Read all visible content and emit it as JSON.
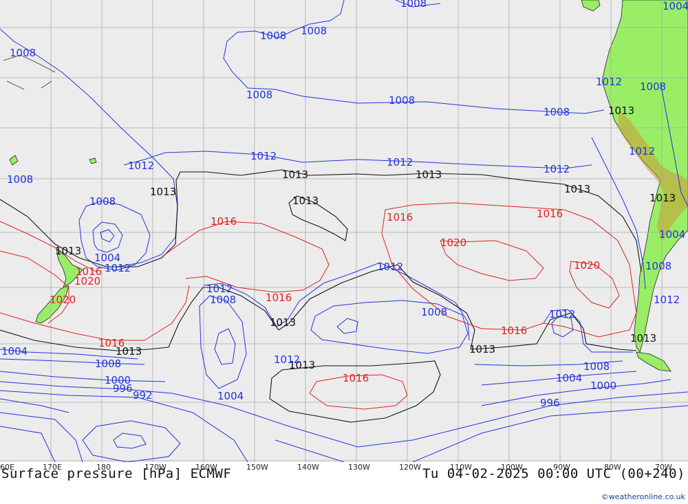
{
  "title": "Surface pressure [hPa] ECMWF",
  "valid_time": "Tu 04-02-2025 00:00 UTC (00+240)",
  "credit": "©weatheronline.co.uk",
  "colors": {
    "ocean": "#ececec",
    "land": "#99ee66",
    "grid": "#aaaaaa",
    "isobar_low": "#2233dd",
    "isobar_mid": "#111111",
    "isobar_high": "#dd2222",
    "terrain": "#cc9933"
  },
  "longitude_ticks": [
    "60E",
    "170E",
    "180",
    "170W",
    "160W",
    "150W",
    "140W",
    "130W",
    "120W",
    "110W",
    "100W",
    "90W",
    "80W",
    "70W"
  ],
  "isobar_labels": [
    "1008",
    "1008",
    "1008",
    "1008",
    "1008",
    "1008",
    "1008",
    "1008",
    "1008",
    "1008",
    "1012",
    "1012",
    "1012",
    "1012",
    "1012",
    "1012",
    "1012",
    "1012",
    "1013",
    "1013",
    "1013",
    "1013",
    "1013",
    "1013",
    "1013",
    "1013",
    "1013",
    "1013",
    "1016",
    "1016",
    "1016",
    "1016",
    "1016",
    "1016",
    "1016",
    "1016",
    "1020",
    "1020",
    "1020",
    "1020",
    "1004",
    "1004",
    "1004",
    "1004",
    "1004",
    "1000",
    "1000",
    "996",
    "996",
    "992",
    "1008",
    "1008",
    "1008",
    "1008",
    "1008",
    "1012",
    "1013",
    "1012",
    "1012",
    "1013",
    "1004",
    "1013",
    "1012"
  ]
}
